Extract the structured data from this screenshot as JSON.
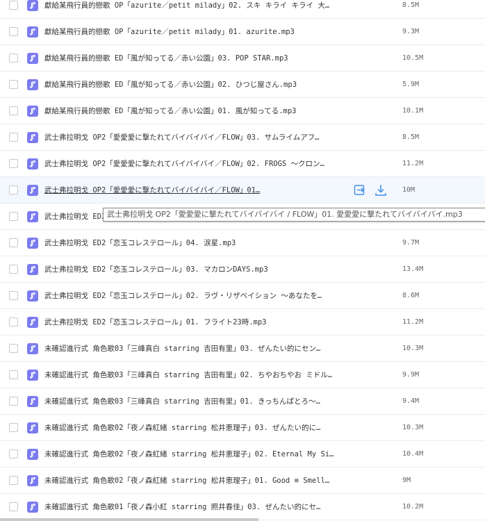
{
  "colors": {
    "file_icon": "#7b7bf0",
    "hover_row": "#f3f8fe",
    "action_icon": "#3f8ee8"
  },
  "icons": {
    "file": "music-note-icon",
    "share": "share-icon",
    "download": "download-icon"
  },
  "files": [
    {
      "name": "獻給某飛行員的戀歌 OP「azurite／petit milady」02. スキ キライ キライ 大…",
      "size": "8.5M"
    },
    {
      "name": "獻給某飛行員的戀歌 OP「azurite／petit milady」01. azurite.mp3",
      "size": "9.3M"
    },
    {
      "name": "獻給某飛行員的戀歌 ED「風が知ってる／赤い公園」03. POP STAR.mp3",
      "size": "10.5M"
    },
    {
      "name": "獻給某飛行員的戀歌 ED「風が知ってる／赤い公園」02. ひつじ屋さん.mp3",
      "size": "5.9M"
    },
    {
      "name": "獻給某飛行員的戀歌 ED「風が知ってる／赤い公園」01. 風が知ってる.mp3",
      "size": "10.1M"
    },
    {
      "name": "武士弗拉明戈 OP2「愛愛愛に撃たれてバイバイバイ／FLOW」03. サムライムアフ…",
      "size": "8.5M"
    },
    {
      "name": "武士弗拉明戈 OP2「愛愛愛に撃たれてバイバイバイ／FLOW」02. FROGS ～クロン…",
      "size": "11.2M"
    },
    {
      "name": "武士弗拉明戈 OP2「愛愛愛に撃たれてバイバイバイ／FLOW」01…",
      "size": "10M"
    },
    {
      "name": "武士弗拉明戈 ED2「恋玉コレステロール」05. ノ ー 7.inst.mp3",
      "size": "9.8M"
    },
    {
      "name": "武士弗拉明戈 ED2「恋玉コレステロール」04. 涙星.mp3",
      "size": "9.7M"
    },
    {
      "name": "武士弗拉明戈 ED2「恋玉コレステロール」03. マカロンDAYS.mp3",
      "size": "13.4M"
    },
    {
      "name": "武士弗拉明戈 ED2「恋玉コレステロール」02. ラヴ・リザベイション ～あなたを…",
      "size": "8.6M"
    },
    {
      "name": "武士弗拉明戈 ED2「恋玉コレステロール」01. フライト23時.mp3",
      "size": "11.2M"
    },
    {
      "name": "未確認進行式 角色歌03「三峰真白 starring 吉田有里」03. ぜんたい的にセン…",
      "size": "10.3M"
    },
    {
      "name": "未確認進行式 角色歌03「三峰真白 starring 吉田有里」02. ちやおちやお ミドル…",
      "size": "9.9M"
    },
    {
      "name": "未確認進行式 角色歌03「三峰真白 starring 吉田有里」01. きっちんぱとろ〜…",
      "size": "9.4M"
    },
    {
      "name": "未確認進行式 角色歌02「夜ノ森紅緒 starring 松井恵理子」03. ぜんたい的に…",
      "size": "10.3M"
    },
    {
      "name": "未確認進行式 角色歌02「夜ノ森紅緒 starring 松井恵理子」02. Eternal My Si…",
      "size": "10.4M"
    },
    {
      "name": "未確認進行式 角色歌02「夜ノ森紅緒 starring 松井恵理子」01. Good ≡ Smell…",
      "size": "9M"
    },
    {
      "name": "未確認進行式 角色歌01「夜ノ森小紅 starring 照井春佳」03. ぜんたい的にセ…",
      "size": "10.2M"
    }
  ],
  "hover_index": 7,
  "tooltip": "武士弗拉明戈 OP2「愛愛愛に撃たれてバイバイバイ / FLOW」01. 愛愛愛に撃たれてバイバイバイ.mp3"
}
